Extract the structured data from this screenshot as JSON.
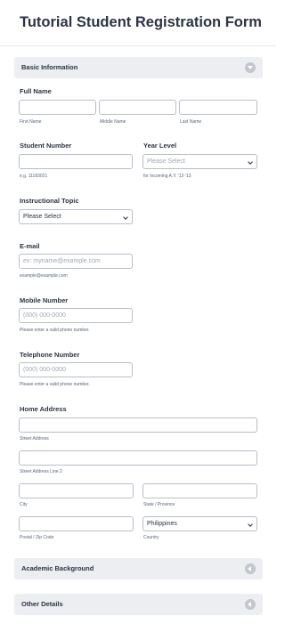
{
  "form": {
    "title": "Tutorial Student Registration Form"
  },
  "sections": {
    "basic": "Basic Information",
    "academic": "Academic Background",
    "other": "Other Details"
  },
  "full_name": {
    "label": "Full Name",
    "first": "First Name",
    "middle": "Middle Name",
    "last": "Last Name"
  },
  "student_number": {
    "label": "Student Number",
    "hint": "e.g. 11183021"
  },
  "year_level": {
    "label": "Year Level",
    "placeholder": "Please Select",
    "hint": "for Incoming A.Y. '12-'13"
  },
  "instructional_topic": {
    "label": "Instructional Topic",
    "value": "Please Select"
  },
  "email": {
    "label": "E-mail",
    "placeholder": "ex: myname@example.com",
    "hint": "example@example.com"
  },
  "mobile": {
    "label": "Mobile Number",
    "placeholder": "(000) 000-0000",
    "hint": "Please enter a valid phone number."
  },
  "telephone": {
    "label": "Telephone Number",
    "placeholder": "(000) 000-0000",
    "hint": "Please enter a valid phone number."
  },
  "address": {
    "label": "Home Address",
    "street": "Street Address",
    "street2": "Street Address Line 2",
    "city": "City",
    "state": "State / Province",
    "postal": "Postal / Zip Code",
    "country_value": "Philippines",
    "country": "Country"
  },
  "icons": {
    "basic_toggle": "chevron-down-icon",
    "academic_toggle": "chevron-left-icon",
    "other_toggle": "chevron-left-icon",
    "select_arrow": "chevron-down-icon"
  }
}
